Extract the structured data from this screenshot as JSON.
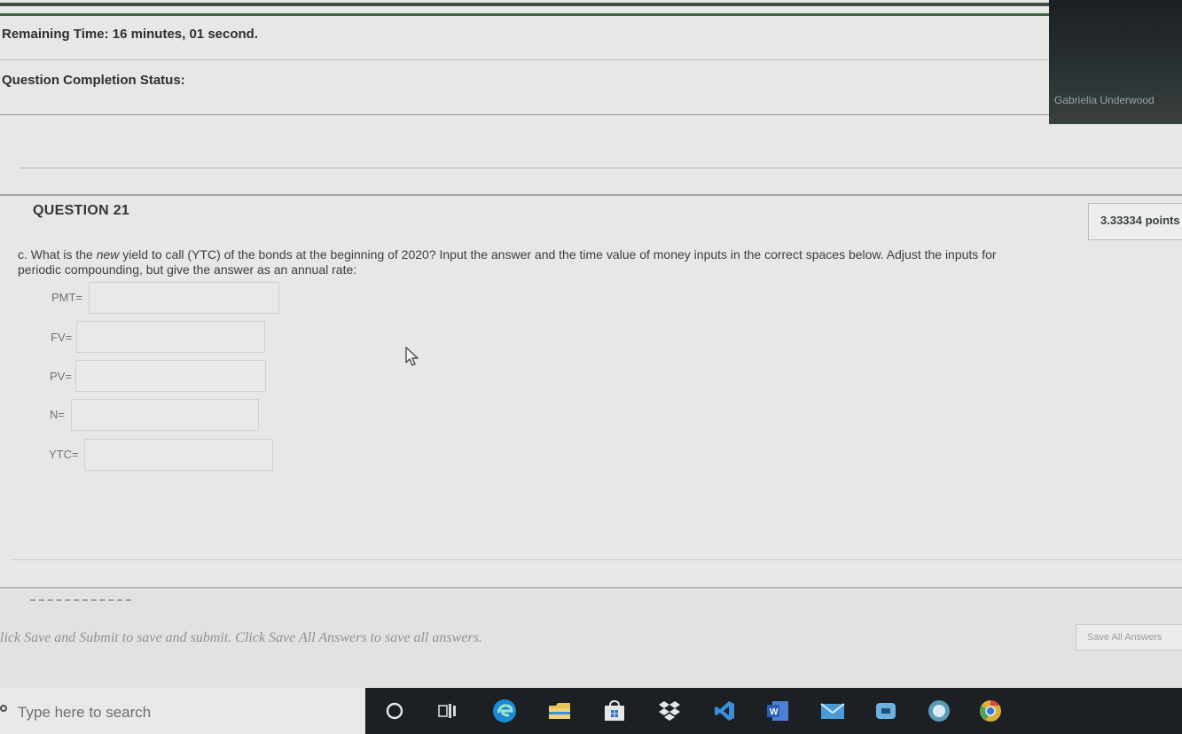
{
  "header": {
    "timer_label": "Remaining Time:",
    "timer_value": "16 minutes, 01 second.",
    "completion_label": "Question Completion Status:"
  },
  "webcam": {
    "participant_name": "Gabriella Underwood"
  },
  "question": {
    "title": "QUESTION 21",
    "points": "3.33334 points",
    "text_prefix": "c. What is the ",
    "text_emphasis": "new",
    "text_suffix": " yield to call (YTC) of the bonds at the beginning of 2020? Input the answer and the time value of money inputs in the correct spaces below. Adjust the inputs for periodic compounding, but give the answer as an annual rate:",
    "fields": [
      {
        "label": "PMT=",
        "value": ""
      },
      {
        "label": "FV=",
        "value": ""
      },
      {
        "label": "PV=",
        "value": ""
      },
      {
        "label": "N=",
        "value": ""
      },
      {
        "label": "YTC=",
        "value": ""
      }
    ]
  },
  "footer": {
    "help_text": "lick Save and Submit to save and submit. Click Save All Answers to save all answers.",
    "save_all_label": "Save All Answers"
  },
  "taskbar": {
    "search_placeholder": "Type here to search",
    "icons": [
      "cortana-icon",
      "task-view-icon",
      "edge-icon",
      "file-explorer-icon",
      "store-icon",
      "dropbox-icon",
      "visual-studio-icon",
      "word-icon",
      "mail-icon",
      "teams-icon",
      "browser-icon",
      "chrome-icon"
    ]
  },
  "colors": {
    "page_bg": "#e7e8e5",
    "timer_bar": "#3d6741",
    "taskbar_bg": "#1c2024"
  }
}
